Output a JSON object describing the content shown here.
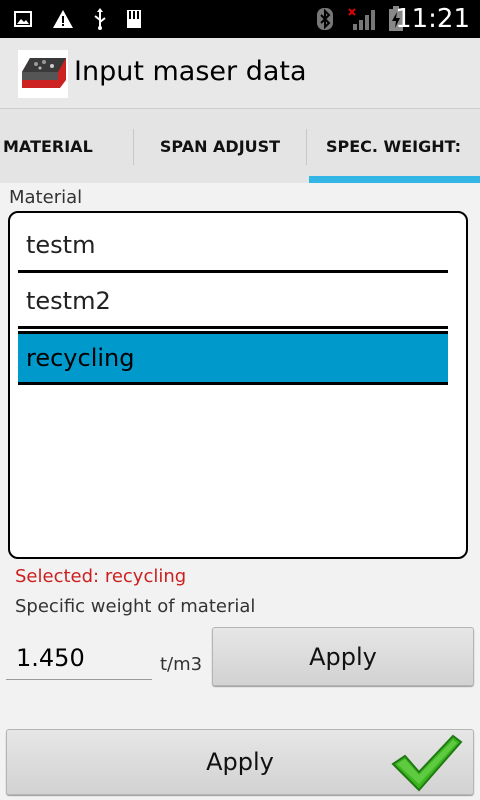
{
  "status_bar": {
    "time": "11:21",
    "icons": [
      "picture-icon",
      "warning-icon",
      "usb-icon",
      "sd-card-icon",
      "bluetooth-icon",
      "signal-icon",
      "battery-icon"
    ]
  },
  "app": {
    "title": "Input maser data"
  },
  "tabs": [
    {
      "label": "MATERIAL",
      "selected": false
    },
    {
      "label": "SPAN ADJUST",
      "selected": false
    },
    {
      "label": "SPEC. WEIGHT:",
      "selected": true
    }
  ],
  "material": {
    "label": "Material",
    "items": [
      {
        "label": "testm",
        "selected": false
      },
      {
        "label": "testm2",
        "selected": false
      },
      {
        "label": "recycling",
        "selected": true
      }
    ],
    "selected_text": "Selected: recycling"
  },
  "specific_weight": {
    "label": "Specific weight of material",
    "value": "1.450",
    "unit": "t/m3",
    "apply_label": "Apply"
  },
  "footer": {
    "apply_label": "Apply"
  },
  "colors": {
    "tab_indicator": "#33b5e5",
    "selected_item": "#0099cc",
    "selected_text": "#cc1f1f",
    "check": "#3cb521"
  }
}
